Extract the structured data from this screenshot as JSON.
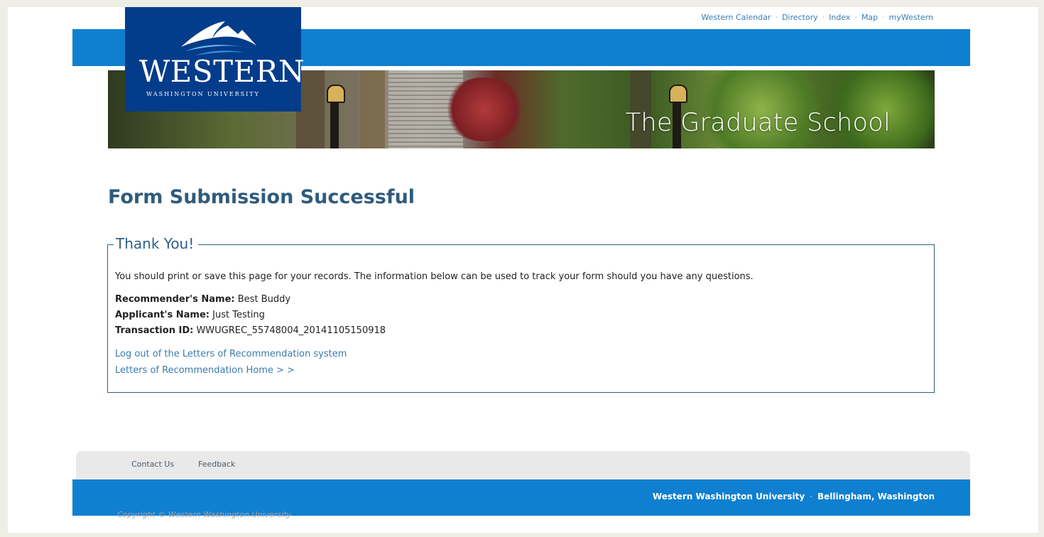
{
  "top_nav": {
    "links": [
      "Western Calendar",
      "Directory",
      "Index",
      "Map",
      "myWestern"
    ],
    "separator": "·"
  },
  "logo": {
    "wordmark": "WESTERN",
    "subtitle": "WASHINGTON UNIVERSITY"
  },
  "banner": {
    "title": "The Graduate School"
  },
  "main": {
    "page_title": "Form Submission Successful",
    "panel": {
      "legend": "Thank You!",
      "intro": "You should print or save this page for your records. The information below can be used to track your form should you have any questions.",
      "fields": [
        {
          "label": "Recommender's Name:",
          "value": "Best Buddy"
        },
        {
          "label": "Applicant's Name:",
          "value": "Just Testing"
        },
        {
          "label": "Transaction ID:",
          "value": "WWUGREC_55748004_20141105150918"
        }
      ],
      "links": {
        "logout": "Log out of the Letters of Recommendation system",
        "home": "Letters of Recommendation Home > >"
      }
    }
  },
  "footer": {
    "links": [
      "Contact Us",
      "Feedback"
    ],
    "university": "Western Washington University",
    "separator": "·",
    "location": "Bellingham, Washington",
    "copyright": "Copyright © Western Washington University"
  },
  "colors": {
    "brand_blue": "#0f7fd0",
    "logo_navy": "#033c8a",
    "title_text": "#2f5b7c",
    "link": "#3b7aab",
    "page_bg": "#efeee6"
  }
}
